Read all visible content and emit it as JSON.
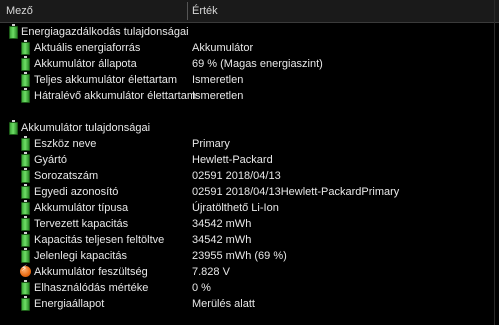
{
  "header": {
    "field": "Mező",
    "value": "Érték"
  },
  "groups": [
    {
      "title": "Energiagazdálkodás tulajdonságai",
      "items": [
        {
          "label": "Aktuális energiaforrás",
          "value": "Akkumulátor",
          "icon": "battery-icon"
        },
        {
          "label": "Akkumulátor állapota",
          "value": "69 % (Magas energiaszint)",
          "icon": "battery-icon"
        },
        {
          "label": "Teljes akkumulátor élettartam",
          "value": "Ismeretlen",
          "icon": "battery-icon"
        },
        {
          "label": "Hátralévő akkumulátor élettartam",
          "value": "Ismeretlen",
          "icon": "battery-icon"
        }
      ]
    },
    {
      "title": "Akkumulátor tulajdonságai",
      "items": [
        {
          "label": "Eszköz neve",
          "value": "Primary",
          "icon": "battery-icon"
        },
        {
          "label": "Gyártó",
          "value": "Hewlett-Packard",
          "icon": "battery-icon"
        },
        {
          "label": "Sorozatszám",
          "value": "02591 2018/04/13",
          "icon": "battery-icon"
        },
        {
          "label": "Egyedi azonosító",
          "value": "02591 2018/04/13Hewlett-PackardPrimary",
          "icon": "battery-icon"
        },
        {
          "label": "Akkumulátor típusa",
          "value": "Újratölthető Li-Ion",
          "icon": "battery-icon"
        },
        {
          "label": "Tervezett kapacitás",
          "value": "34542 mWh",
          "icon": "battery-icon"
        },
        {
          "label": "Kapacitás teljesen feltöltve",
          "value": "34542 mWh",
          "icon": "battery-icon"
        },
        {
          "label": "Jelenlegi kapacitás",
          "value": "23955 mWh  (69 %)",
          "icon": "battery-icon"
        },
        {
          "label": "Akkumulátor feszültség",
          "value": "7.828 V",
          "icon": "voltage-icon"
        },
        {
          "label": "Elhasználódás mértéke",
          "value": "0 %",
          "icon": "battery-icon"
        },
        {
          "label": "Energiaállapot",
          "value": "Merülés alatt",
          "icon": "battery-icon"
        }
      ]
    }
  ]
}
